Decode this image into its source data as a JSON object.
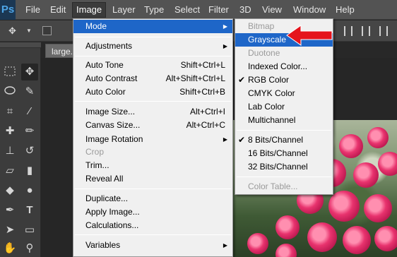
{
  "app": {
    "logo": "Ps"
  },
  "menubar": {
    "items": [
      "File",
      "Edit",
      "Image",
      "Layer",
      "Type",
      "Select",
      "Filter",
      "3D",
      "View",
      "Window",
      "Help"
    ],
    "active": "Image"
  },
  "document": {
    "tab_label": "large."
  },
  "image_menu": {
    "mode": "Mode",
    "adjustments": "Adjustments",
    "auto_tone": {
      "label": "Auto Tone",
      "shortcut": "Shift+Ctrl+L"
    },
    "auto_contrast": {
      "label": "Auto Contrast",
      "shortcut": "Alt+Shift+Ctrl+L"
    },
    "auto_color": {
      "label": "Auto Color",
      "shortcut": "Shift+Ctrl+B"
    },
    "image_size": {
      "label": "Image Size...",
      "shortcut": "Alt+Ctrl+I"
    },
    "canvas_size": {
      "label": "Canvas Size...",
      "shortcut": "Alt+Ctrl+C"
    },
    "image_rotation": "Image Rotation",
    "crop": "Crop",
    "trim": "Trim...",
    "reveal_all": "Reveal All",
    "duplicate": "Duplicate...",
    "apply_image": "Apply Image...",
    "calculations": "Calculations...",
    "variables": "Variables"
  },
  "mode_menu": {
    "bitmap": "Bitmap",
    "grayscale": "Grayscale",
    "duotone": "Duotone",
    "indexed_color": "Indexed Color...",
    "rgb_color": "RGB Color",
    "cmyk_color": "CMYK Color",
    "lab_color": "Lab Color",
    "multichannel": "Multichannel",
    "bits8": "8 Bits/Channel",
    "bits16": "16 Bits/Channel",
    "bits32": "32 Bits/Channel",
    "color_table": "Color Table...",
    "checked": [
      "RGB Color",
      "8 Bits/Channel"
    ]
  },
  "colors": {
    "menu_highlight": "#1e66c8",
    "annotation_arrow": "#e5141c",
    "menubar_bg": "#535353"
  }
}
